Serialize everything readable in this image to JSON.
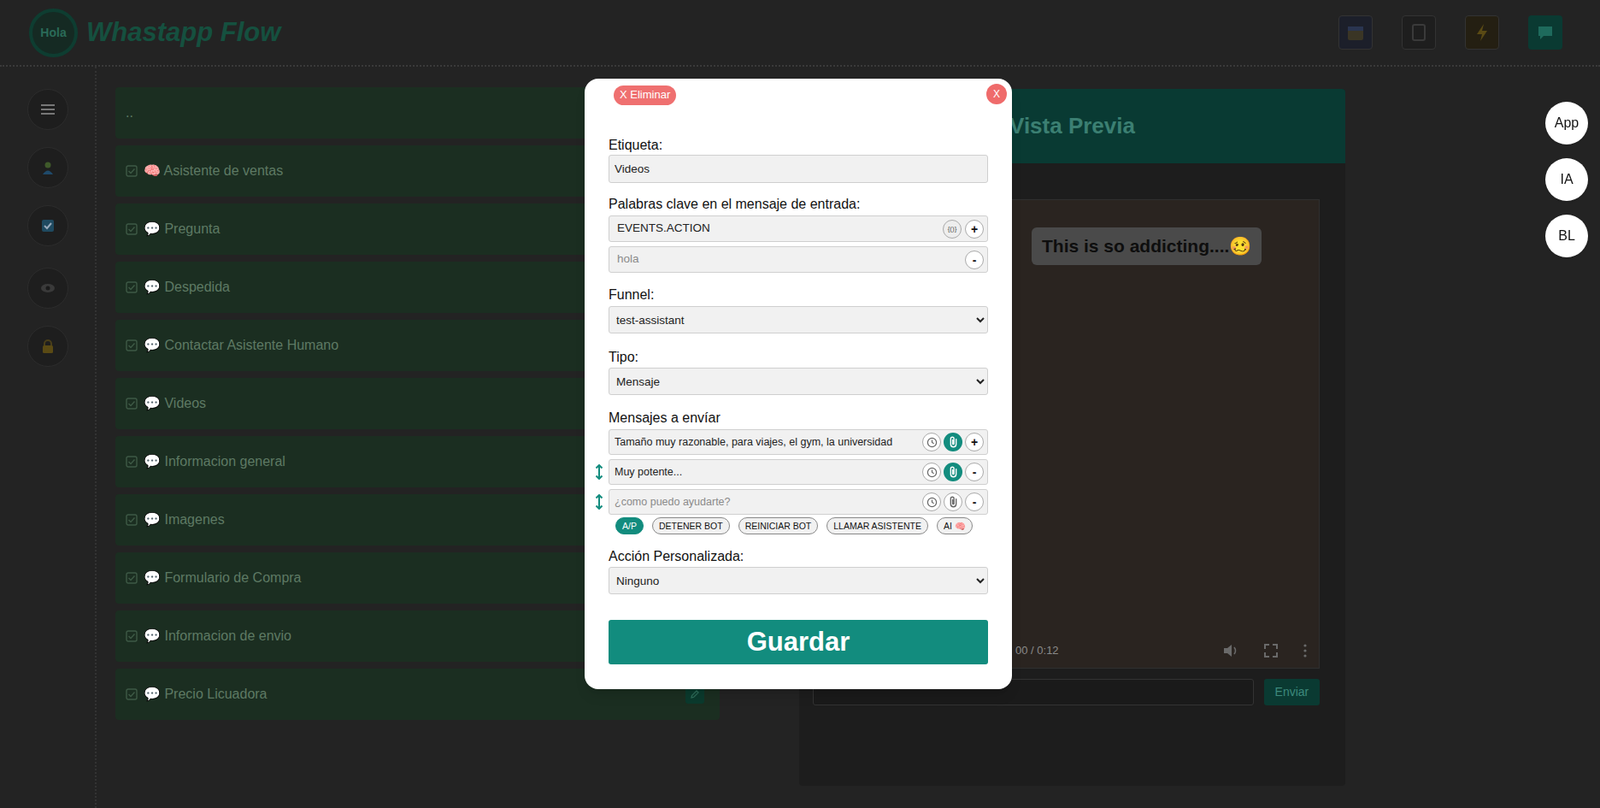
{
  "app": {
    "logo": "Hola",
    "title": "Whastapp Flow"
  },
  "flows": [
    {
      "label": "..",
      "kind": "up"
    },
    {
      "label": "🧠 Asistente de ventas",
      "kind": "flow"
    },
    {
      "label": "💬 Pregunta",
      "kind": "flow"
    },
    {
      "label": "💬 Despedida",
      "kind": "flow"
    },
    {
      "label": "💬 Contactar Asistente Humano",
      "kind": "flow"
    },
    {
      "label": "💬 Videos",
      "kind": "flow"
    },
    {
      "label": "💬 Informacion general",
      "kind": "flow"
    },
    {
      "label": "💬 Imagenes",
      "kind": "flow"
    },
    {
      "label": "💬 Formulario de Compra",
      "kind": "flow"
    },
    {
      "label": "💬 Informacion de envio",
      "kind": "flow"
    },
    {
      "label": "💬 Precio Licuadora",
      "kind": "flow"
    }
  ],
  "preview": {
    "title": "Vista Previa",
    "message": "This is so addicting....🥴",
    "time": "00 / 0:12",
    "send": "Enviar"
  },
  "side_buttons": [
    "App",
    "IA",
    "BL"
  ],
  "editor": {
    "delete": "X Eliminar",
    "close": "X",
    "label_field": {
      "label": "Etiqueta:",
      "value": "Videos"
    },
    "keywords": {
      "label": "Palabras clave en el mensaje de entrada:",
      "variable_button": "{()}",
      "items": [
        {
          "value": "EVENTS.ACTION",
          "button": "+"
        },
        {
          "placeholder": "hola",
          "button": "-"
        }
      ]
    },
    "funnel": {
      "label": "Funnel:",
      "value": "test-assistant"
    },
    "type": {
      "label": "Tipo:",
      "value": "Mensaje"
    },
    "messages": {
      "label": "Mensajes a envíar",
      "items": [
        {
          "value": "Tamaño muy razonable, para viajes, el gym, la universidad",
          "attached": true,
          "button": "+"
        },
        {
          "value": "Muy potente...",
          "attached": true,
          "button": "-"
        },
        {
          "placeholder": "¿como puedo ayudarte?",
          "attached": false,
          "button": "-"
        }
      ]
    },
    "chips": [
      {
        "label": "A/P",
        "selected": true
      },
      {
        "label": "DETENER BOT",
        "selected": false
      },
      {
        "label": "REINICIAR BOT",
        "selected": false
      },
      {
        "label": "LLAMAR ASISTENTE",
        "selected": false
      },
      {
        "label": "AI 🧠",
        "selected": false
      }
    ],
    "action": {
      "label": "Acción Personalizada:",
      "value": "Ninguno"
    },
    "save": "Guardar"
  }
}
